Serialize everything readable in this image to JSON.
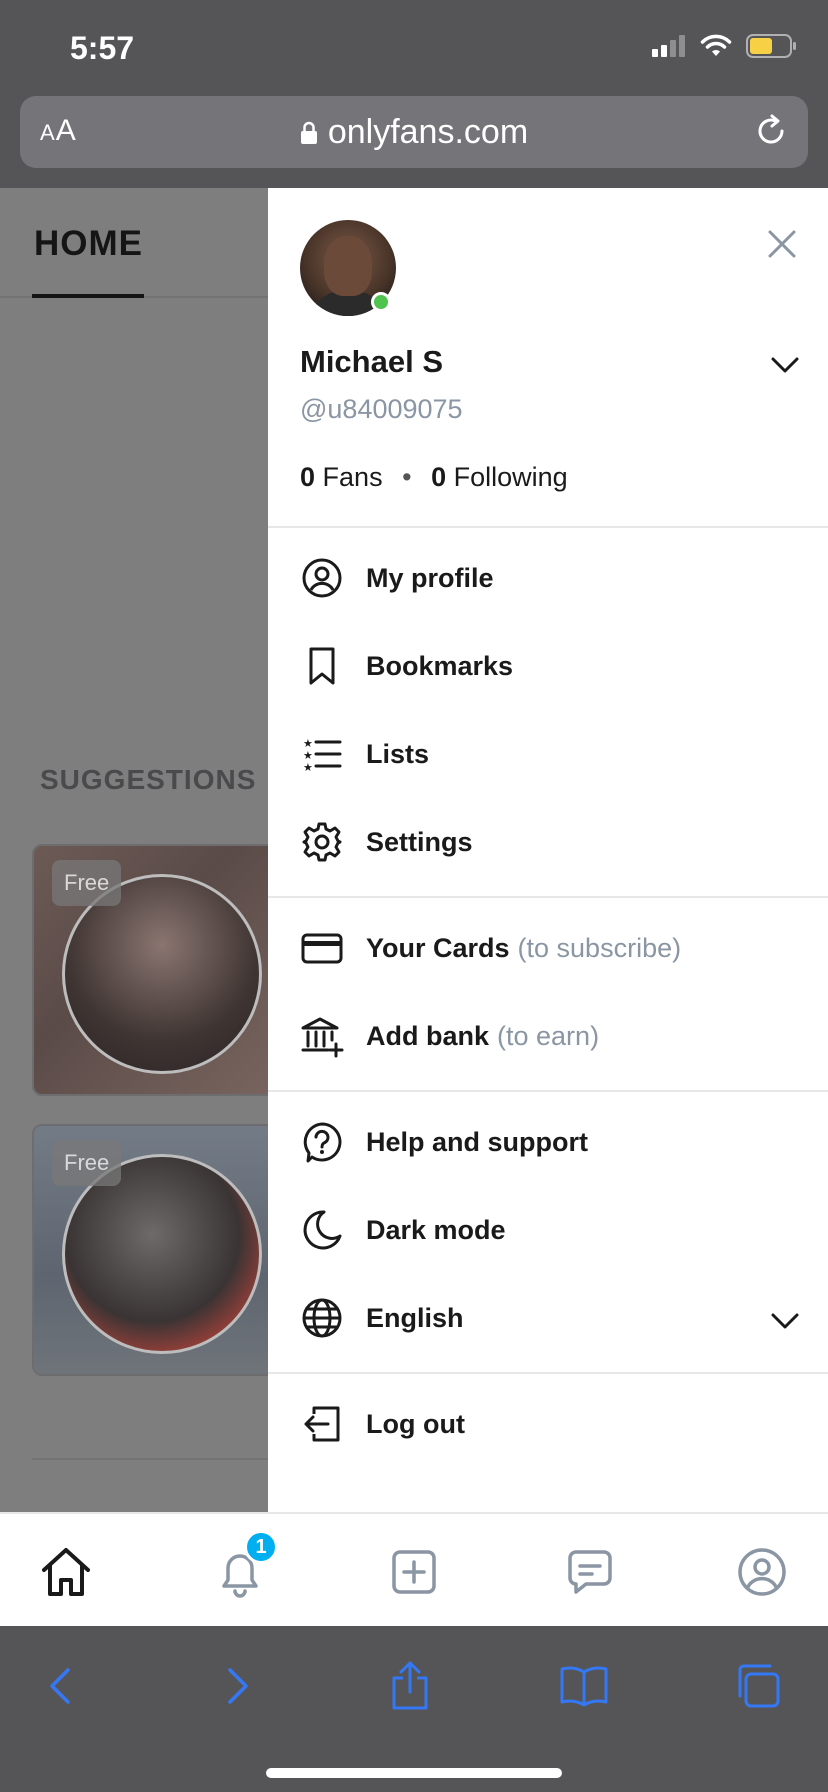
{
  "status_bar": {
    "time": "5:57"
  },
  "browser": {
    "text_size_label": "AA",
    "url": "onlyfans.com"
  },
  "background_page": {
    "tab_home": "HOME",
    "suggestions_title": "SUGGESTIONS",
    "cards": [
      {
        "badge": "Free"
      },
      {
        "badge": "Free"
      }
    ]
  },
  "drawer": {
    "profile": {
      "name": "Michael S",
      "handle": "@u84009075",
      "fans_count": "0",
      "fans_label": "Fans",
      "following_count": "0",
      "following_label": "Following"
    },
    "menu_group_1": [
      {
        "label": "My profile",
        "icon": "user-circle-icon"
      },
      {
        "label": "Bookmarks",
        "icon": "bookmark-icon"
      },
      {
        "label": "Lists",
        "icon": "list-icon"
      },
      {
        "label": "Settings",
        "icon": "gear-icon"
      }
    ],
    "menu_group_2": [
      {
        "label": "Your Cards",
        "sub": "(to subscribe)",
        "icon": "credit-card-icon"
      },
      {
        "label": "Add bank",
        "sub": "(to earn)",
        "icon": "bank-icon"
      }
    ],
    "menu_group_3": [
      {
        "label": "Help and support",
        "icon": "help-icon"
      },
      {
        "label": "Dark mode",
        "icon": "moon-icon"
      },
      {
        "label": "English",
        "icon": "globe-icon"
      }
    ],
    "logout": {
      "label": "Log out",
      "icon": "logout-icon"
    }
  },
  "app_nav": {
    "notifications_badge": "1"
  },
  "colors": {
    "accent": "#00aff0",
    "online": "#4ec34e",
    "muted": "#8a96a3",
    "safari_blue": "#3478f6"
  }
}
